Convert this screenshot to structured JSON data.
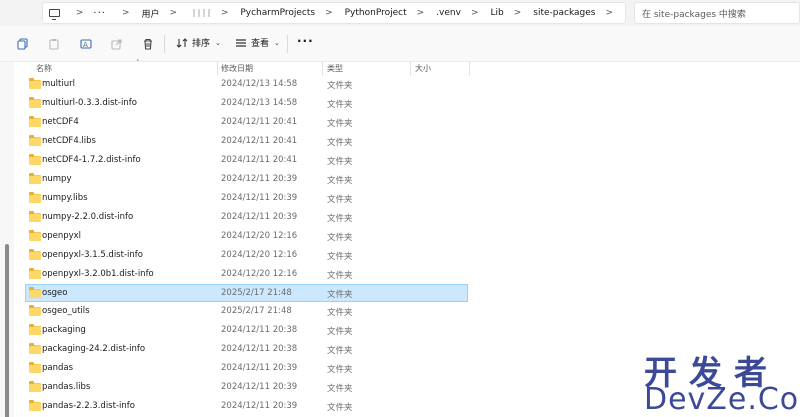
{
  "address_bar": {
    "ellipsis": "···",
    "crumbs": [
      "用户",
      "PycharmProjects",
      "PythonProject",
      ".venv",
      "Lib",
      "site-packages"
    ],
    "separator": ">"
  },
  "search": {
    "placeholder": "在 site-packages 中搜索"
  },
  "command_bar": {
    "sort_label": "排序",
    "view_label": "查看",
    "more_label": "···"
  },
  "columns": {
    "name": "名称",
    "date": "修改日期",
    "type": "类型",
    "size": "大小"
  },
  "files": [
    {
      "name": "multiurl",
      "date": "2024/12/13 14:58",
      "type": "文件夹"
    },
    {
      "name": "multiurl-0.3.3.dist-info",
      "date": "2024/12/13 14:58",
      "type": "文件夹"
    },
    {
      "name": "netCDF4",
      "date": "2024/12/11 20:41",
      "type": "文件夹"
    },
    {
      "name": "netCDF4.libs",
      "date": "2024/12/11 20:41",
      "type": "文件夹"
    },
    {
      "name": "netCDF4-1.7.2.dist-info",
      "date": "2024/12/11 20:41",
      "type": "文件夹"
    },
    {
      "name": "numpy",
      "date": "2024/12/11 20:39",
      "type": "文件夹"
    },
    {
      "name": "numpy.libs",
      "date": "2024/12/11 20:39",
      "type": "文件夹"
    },
    {
      "name": "numpy-2.2.0.dist-info",
      "date": "2024/12/11 20:39",
      "type": "文件夹"
    },
    {
      "name": "openpyxl",
      "date": "2024/12/20 12:16",
      "type": "文件夹"
    },
    {
      "name": "openpyxl-3.1.5.dist-info",
      "date": "2024/12/20 12:16",
      "type": "文件夹"
    },
    {
      "name": "openpyxl-3.2.0b1.dist-info",
      "date": "2024/12/20 12:16",
      "type": "文件夹"
    },
    {
      "name": "osgeo",
      "date": "2025/2/17 21:48",
      "type": "文件夹",
      "selected": true
    },
    {
      "name": "osgeo_utils",
      "date": "2025/2/17 21:48",
      "type": "文件夹"
    },
    {
      "name": "packaging",
      "date": "2024/12/11 20:38",
      "type": "文件夹"
    },
    {
      "name": "packaging-24.2.dist-info",
      "date": "2024/12/11 20:38",
      "type": "文件夹"
    },
    {
      "name": "pandas",
      "date": "2024/12/11 20:39",
      "type": "文件夹"
    },
    {
      "name": "pandas.libs",
      "date": "2024/12/11 20:39",
      "type": "文件夹"
    },
    {
      "name": "pandas-2.2.3.dist-info",
      "date": "2024/12/11 20:39",
      "type": "文件夹"
    }
  ],
  "watermark": {
    "line1": "开发者",
    "line2": "DevZe.CoM"
  },
  "colors": {
    "selection_bg": "#cce8ff",
    "selection_border": "#99d1ff",
    "folder": "#ffd766",
    "watermark": "#2b3a8f"
  }
}
